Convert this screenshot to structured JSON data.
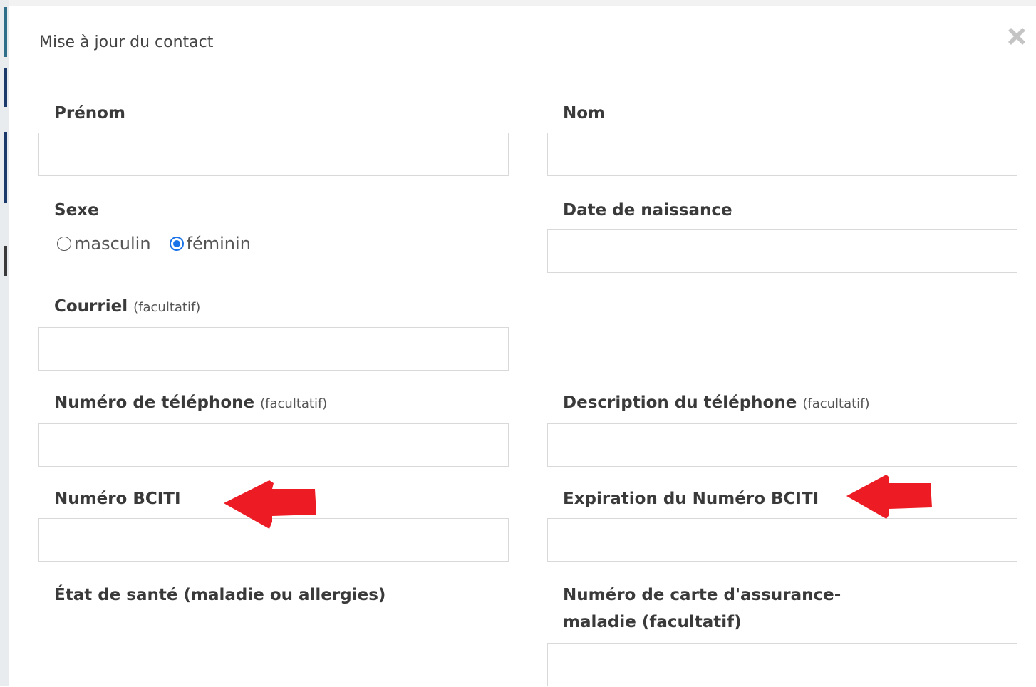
{
  "dialog": {
    "title": "Mise à jour du contact",
    "close_icon": "close-icon"
  },
  "optional_suffix": "(facultatif)",
  "fields": {
    "prenom": {
      "label": "Prénom",
      "value": ""
    },
    "nom": {
      "label": "Nom",
      "value": ""
    },
    "sexe": {
      "label": "Sexe",
      "options": [
        "masculin",
        "féminin"
      ],
      "selected": "féminin"
    },
    "date_naissance": {
      "label": "Date de naissance",
      "value": ""
    },
    "courriel": {
      "label": "Courriel",
      "optional": "(facultatif)",
      "value": ""
    },
    "telephone": {
      "label": "Numéro de téléphone",
      "optional": "(facultatif)",
      "value": ""
    },
    "telephone_description": {
      "label": "Description du téléphone",
      "optional": "(facultatif)",
      "value": ""
    },
    "bciti": {
      "label": "Numéro BCITI",
      "value": ""
    },
    "bciti_expiration": {
      "label": "Expiration du Numéro BCITI",
      "value": ""
    },
    "etat_sante": {
      "label": "État de santé (maladie ou allergies)"
    },
    "carte_assurance": {
      "label": "Numéro de carte d'assurance-maladie (facultatif)",
      "value": ""
    }
  },
  "annotations": {
    "arrow_color": "#ed1c24",
    "arrow_icon": "red-arrow-left-icon"
  },
  "colors": {
    "radio_selected": "#1a73e8",
    "input_border": "#d9d9d9"
  }
}
